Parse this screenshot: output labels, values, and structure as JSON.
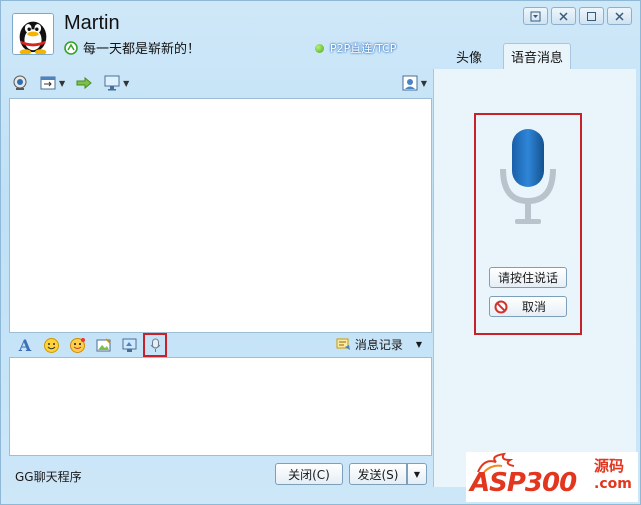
{
  "header": {
    "contact_name": "Martin",
    "signature": "每一天都是崭新的！",
    "connection_status": "P2P直连/TCP"
  },
  "title_controls": [
    "menu-icon",
    "close-icon",
    "minimize-icon",
    "close-icon"
  ],
  "toolbar": {
    "icons": [
      "video-icon",
      "file-transfer-icon",
      "arrow-icon",
      "remote-desktop-icon"
    ],
    "right_icon": "contact-card-icon"
  },
  "format_bar": {
    "font_label": "A",
    "icons": [
      "emoticon-icon",
      "magic-emoticon-icon",
      "screenshot-icon",
      "screen-share-icon",
      "voice-message-icon"
    ],
    "history_label": "消息记录"
  },
  "bottom_bar": {
    "program_name": "GG聊天程序",
    "close_label": "关闭(C)",
    "send_label": "发送(S)"
  },
  "side_tabs": [
    {
      "label": "头像",
      "active": false
    },
    {
      "label": "语音消息",
      "active": true
    }
  ],
  "voice_panel": {
    "press_label": "请按住说话",
    "cancel_label": "取消"
  },
  "watermark": {
    "brand": "ASP300",
    "cn": "源码",
    "domain": ".com"
  },
  "colors": {
    "highlight": "#c8212a",
    "mic_blue": "#1e6fb8",
    "window_bg": "#c8e4f6"
  }
}
